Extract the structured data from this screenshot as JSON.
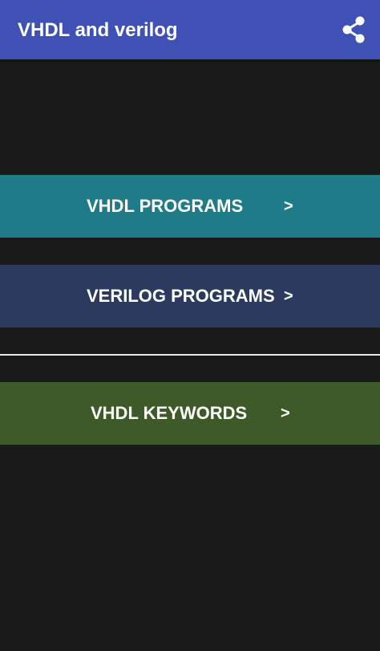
{
  "appbar": {
    "title": "VHDL and verilog",
    "color": "#3f51b5",
    "share_icon": "share-icon"
  },
  "menu": {
    "items": [
      {
        "label": "VHDL PROGRAMS",
        "arrow": ">",
        "color": "#1e7b87"
      },
      {
        "label": "VERILOG PROGRAMS",
        "arrow": ">",
        "color": "#2b3a5e"
      },
      {
        "label": "VHDL KEYWORDS",
        "arrow": ">",
        "color": "#3e5a28"
      }
    ]
  },
  "background_color": "#1a1a1a"
}
